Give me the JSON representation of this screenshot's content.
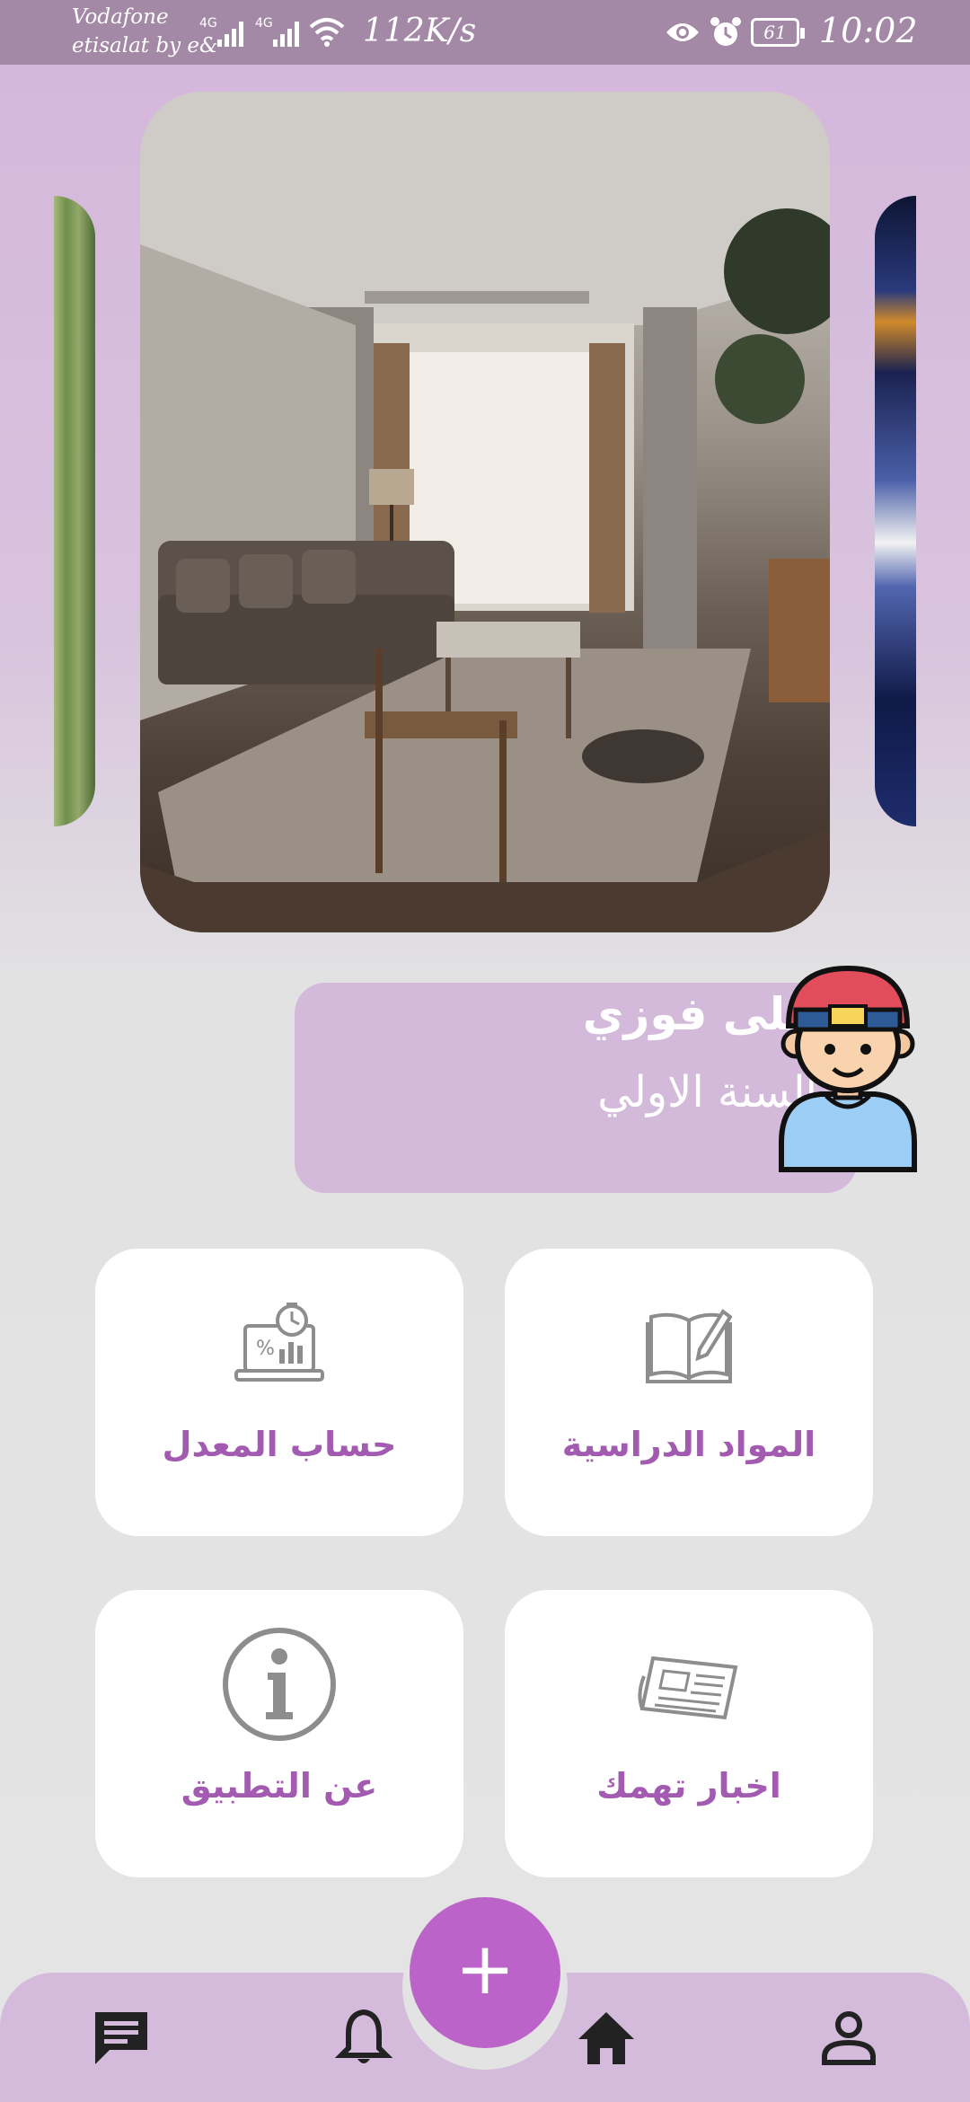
{
  "status_bar": {
    "carrier_1": "Vodafone",
    "carrier_2": "etisalat by e&",
    "net_1": "4G",
    "net_2": "4G",
    "speed": "112K/s",
    "battery": "61",
    "time": "10:02"
  },
  "profile": {
    "name": "على فوزي",
    "year": "السنة الاولي"
  },
  "tiles": [
    {
      "label": "المواد الدراسية",
      "icon": "book-pencil-icon"
    },
    {
      "label": "حساب المعدل",
      "icon": "grade-calculator-icon"
    },
    {
      "label": "اخبار تهمك",
      "icon": "newspaper-icon"
    },
    {
      "label": "عن التطبيق",
      "icon": "info-icon"
    }
  ],
  "fab": {
    "label": "+",
    "icon": "plus-icon"
  },
  "bottom_nav": [
    {
      "icon": "chat-icon"
    },
    {
      "icon": "bell-icon"
    },
    {
      "icon": "home-icon"
    },
    {
      "icon": "person-icon"
    }
  ],
  "colors": {
    "accent": "#bb63c8",
    "tile_label": "#a25bb0",
    "card": "#d3b9da",
    "status_bar": "#a489a6"
  }
}
